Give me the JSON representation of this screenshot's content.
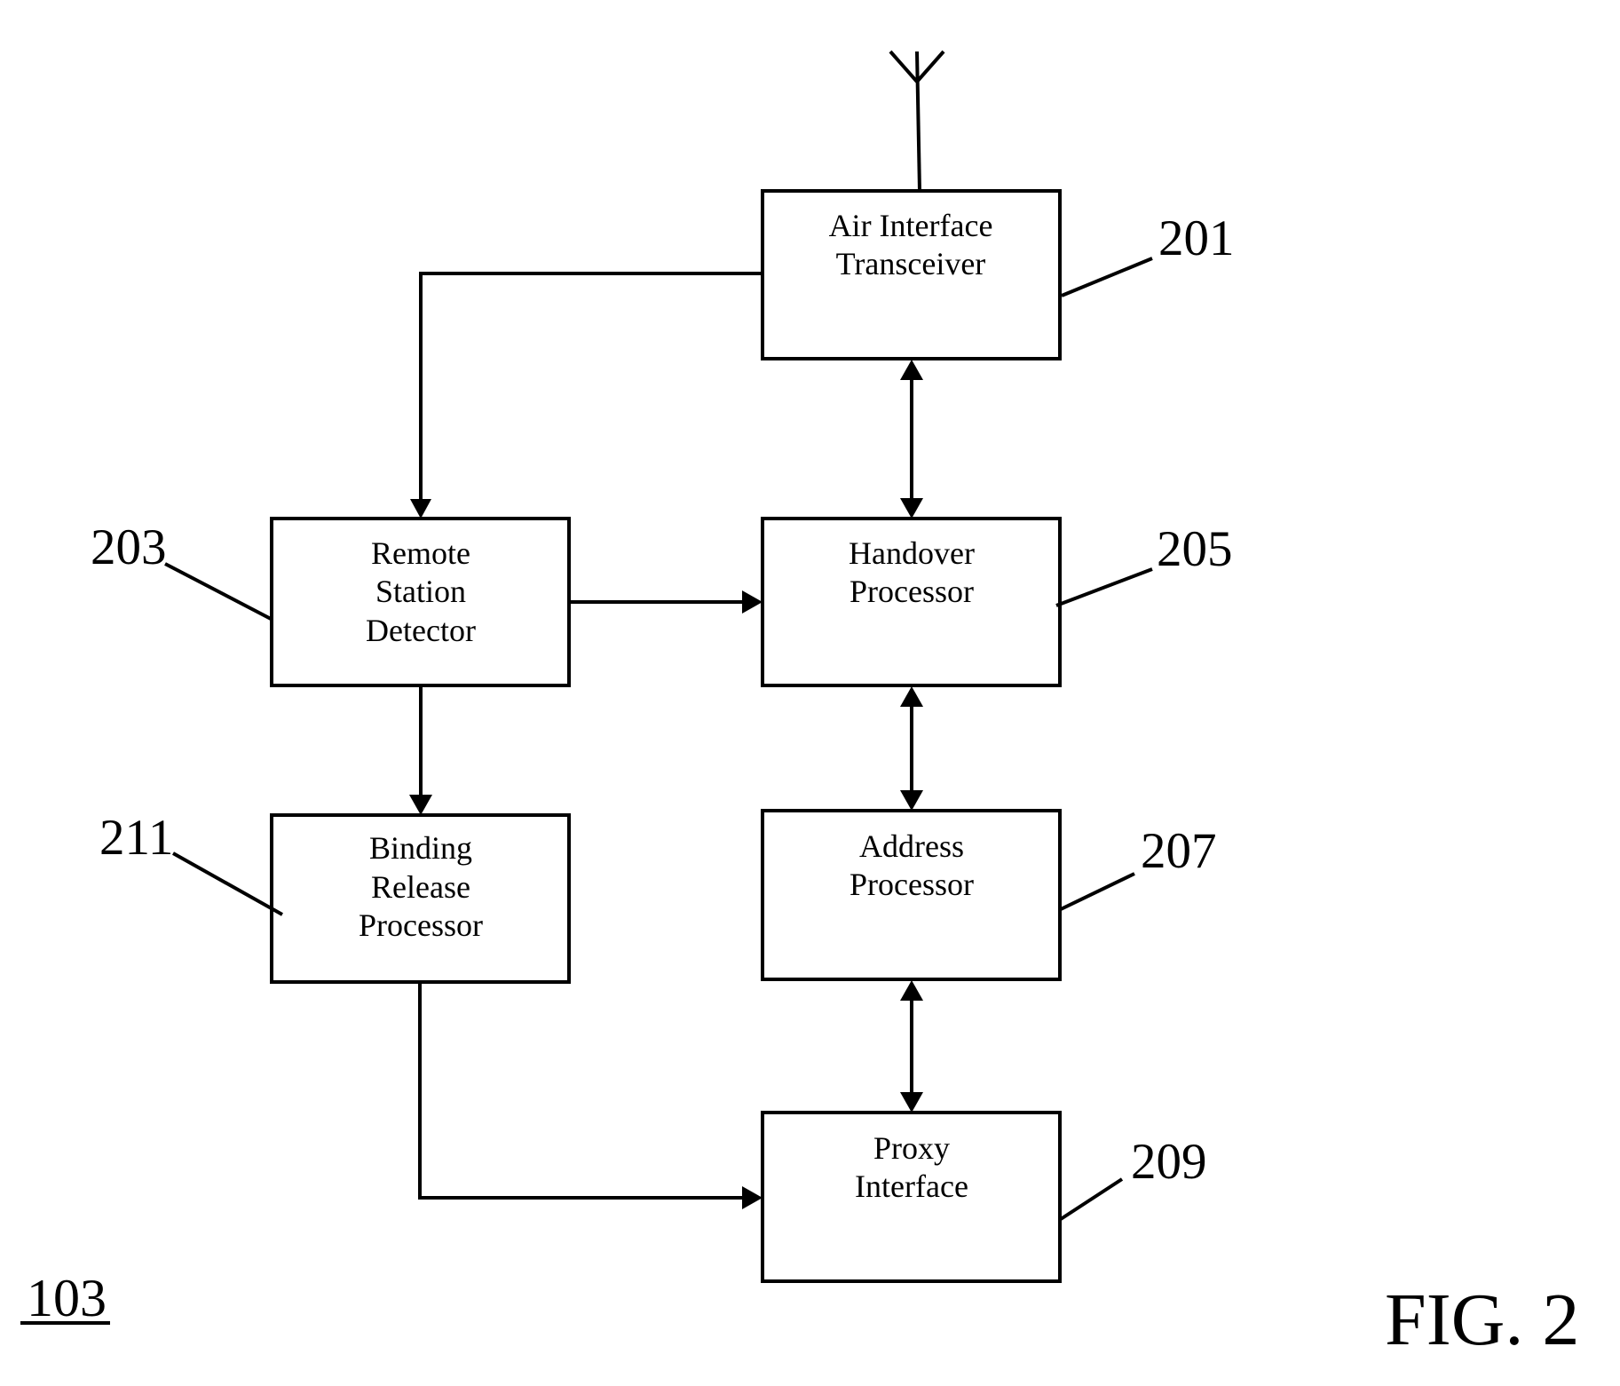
{
  "figure": {
    "caption": "FIG. 2",
    "diagram_id": "103"
  },
  "blocks": {
    "air_interface_transceiver": {
      "ref": "201",
      "lines": [
        "Air Interface",
        "Transceiver"
      ]
    },
    "remote_station_detector": {
      "ref": "203",
      "lines": [
        "Remote",
        "Station",
        "Detector"
      ]
    },
    "handover_processor": {
      "ref": "205",
      "lines": [
        "Handover",
        "Processor"
      ]
    },
    "address_processor": {
      "ref": "207",
      "lines": [
        "Address",
        "Processor"
      ]
    },
    "proxy_interface": {
      "ref": "209",
      "lines": [
        "Proxy",
        "Interface"
      ]
    },
    "binding_release_processor": {
      "ref": "211",
      "lines": [
        "Binding",
        "Release",
        "Processor"
      ]
    }
  },
  "connections": [
    {
      "from": "air_interface_transceiver",
      "to": "remote_station_detector",
      "direction": "one-way"
    },
    {
      "from": "air_interface_transceiver",
      "to": "handover_processor",
      "direction": "bidirectional"
    },
    {
      "from": "remote_station_detector",
      "to": "handover_processor",
      "direction": "one-way"
    },
    {
      "from": "remote_station_detector",
      "to": "binding_release_processor",
      "direction": "one-way"
    },
    {
      "from": "handover_processor",
      "to": "address_processor",
      "direction": "bidirectional"
    },
    {
      "from": "address_processor",
      "to": "proxy_interface",
      "direction": "bidirectional"
    },
    {
      "from": "binding_release_processor",
      "to": "proxy_interface",
      "direction": "one-way"
    }
  ],
  "icons": {
    "antenna": "antenna-icon"
  }
}
